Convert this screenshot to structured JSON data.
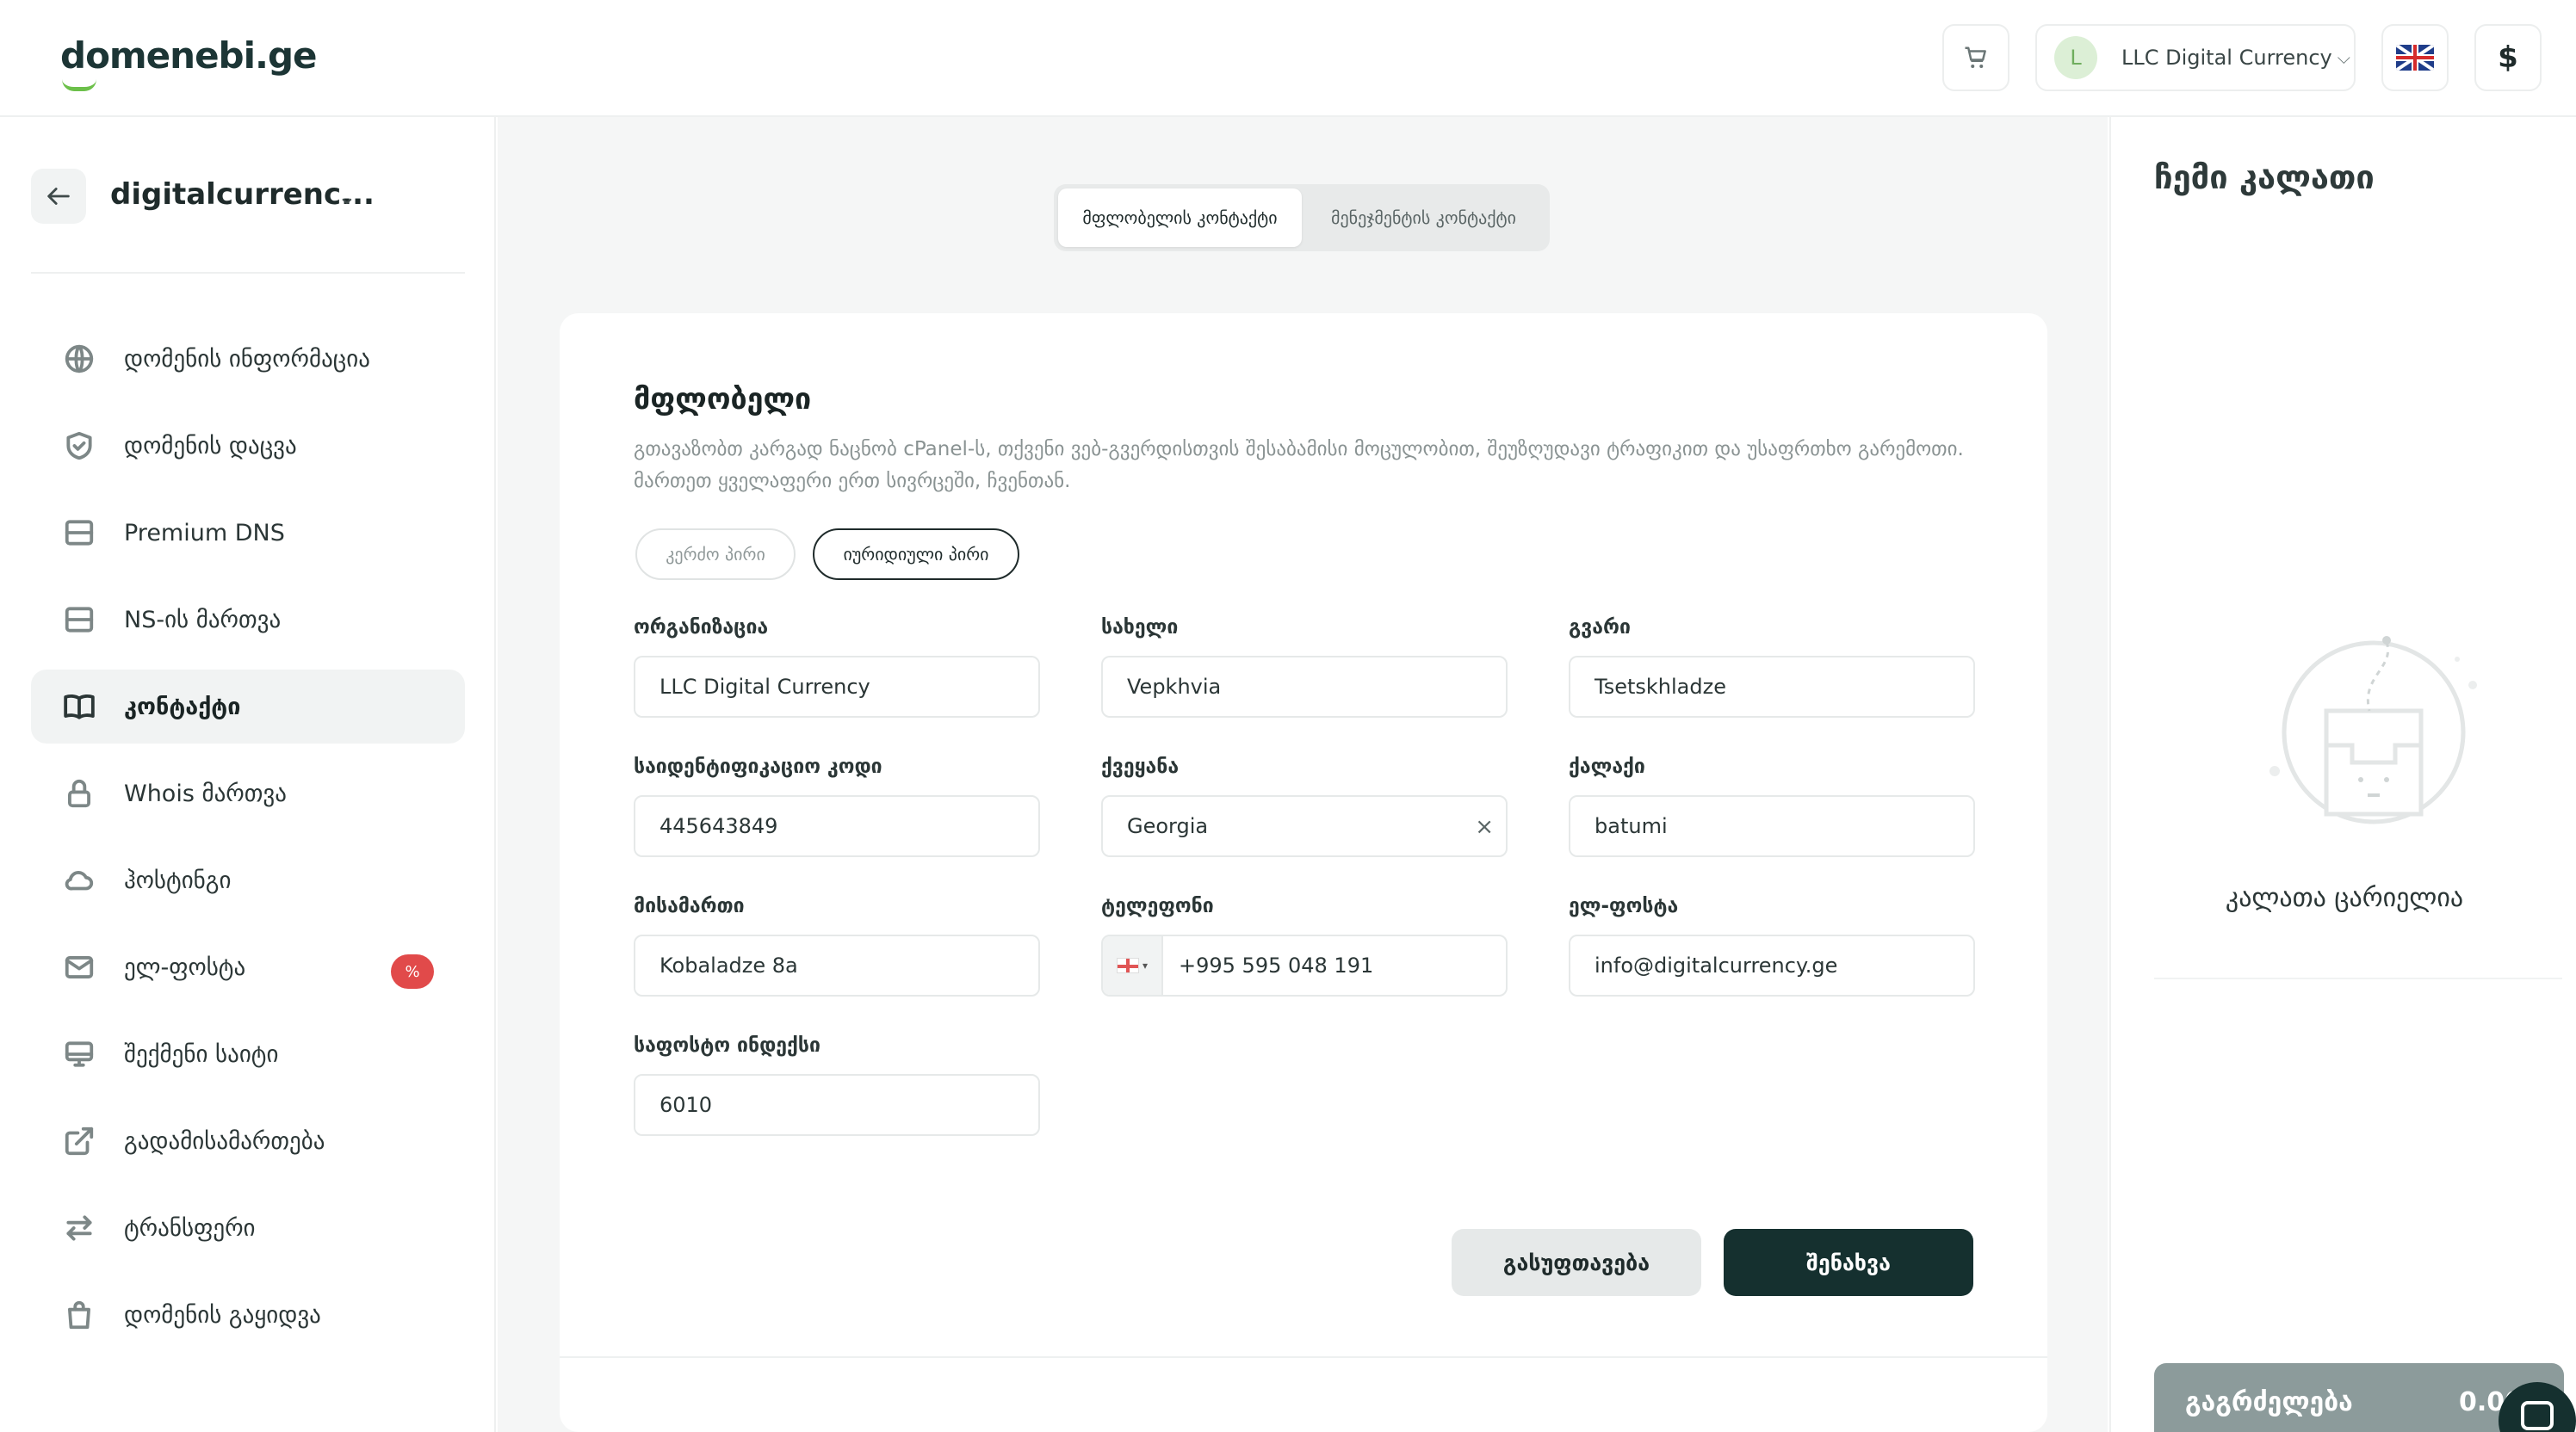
{
  "header": {
    "logo": "domenebi.ge",
    "account": {
      "initial": "L",
      "name": "LLC Digital Currency"
    },
    "currency_symbol": "$",
    "icons": {
      "cart": "cart-icon",
      "flag": "uk-flag-icon",
      "chevron": "chevron-down-icon"
    }
  },
  "sidebar": {
    "domain": "digitalcurrenc...",
    "items": [
      {
        "label": "დომენის ინფორმაცია",
        "icon": "globe-icon"
      },
      {
        "label": "დომენის დაცვა",
        "icon": "shield-check-icon"
      },
      {
        "label": "Premium DNS",
        "icon": "server-icon"
      },
      {
        "label": "NS-ის მართვა",
        "icon": "server-icon"
      },
      {
        "label": "კონტაქტი",
        "icon": "book-icon",
        "active": true
      },
      {
        "label": "Whois მართვა",
        "icon": "lock-icon"
      },
      {
        "label": "ჰოსტინგი",
        "icon": "cloud-icon"
      },
      {
        "label": "ელ-ფოსტა",
        "icon": "mail-icon",
        "badge": "%"
      },
      {
        "label": "შექმენი საიტი",
        "icon": "monitor-icon"
      },
      {
        "label": "გადამისამართება",
        "icon": "external-link-icon"
      },
      {
        "label": "ტრანსფერი",
        "icon": "transfer-arrows-icon"
      },
      {
        "label": "დომენის გაყიდვა",
        "icon": "shopping-bag-icon"
      }
    ]
  },
  "main": {
    "tabs": [
      "მფლობელის კონტაქტი",
      "მენეჯმენტის კონტაქტი"
    ],
    "active_tab": 0,
    "card": {
      "title": "მფლობელი",
      "description": "გთავაზობთ კარგად ნაცნობ cPanel-ს, თქვენი ვებ-გვერდისთვის შესაბამისი მოცულობით, შეუზღუდავი ტრაფიკით და უსაფრთხო გარემოთი. მართეთ ყველაფერი ერთ სივრცეში, ჩვენთან.",
      "person_types": [
        "კერძო პირი",
        "იურიდიული პირი"
      ],
      "active_type": 1,
      "fields": {
        "organization": {
          "label": "ორგანიზაცია",
          "value": "LLC Digital Currency"
        },
        "first_name": {
          "label": "სახელი",
          "value": "Vepkhvia"
        },
        "last_name": {
          "label": "გვარი",
          "value": "Tsetskhladze"
        },
        "id_code": {
          "label": "საიდენტიფიკაციო კოდი",
          "value": "445643849"
        },
        "country": {
          "label": "ქვეყანა",
          "value": "Georgia",
          "clear": "×"
        },
        "city": {
          "label": "ქალაქი",
          "value": "batumi"
        },
        "address": {
          "label": "მისამართი",
          "value": "Kobaladze 8a"
        },
        "phone": {
          "label": "ტელეფონი",
          "value": "+995 595 048 191"
        },
        "email": {
          "label": "ელ-ფოსტა",
          "value": "info@digitalcurrency.ge"
        },
        "postal": {
          "label": "საფოსტო ინდექსი",
          "value": "6010"
        }
      },
      "reset_label": "გასუფთავება",
      "save_label": "შენახვა"
    }
  },
  "cart": {
    "title": "ჩემი კალათი",
    "empty_text": "კალათა ცარიელია",
    "continue_label": "გაგრძელება",
    "total": "0.00"
  }
}
